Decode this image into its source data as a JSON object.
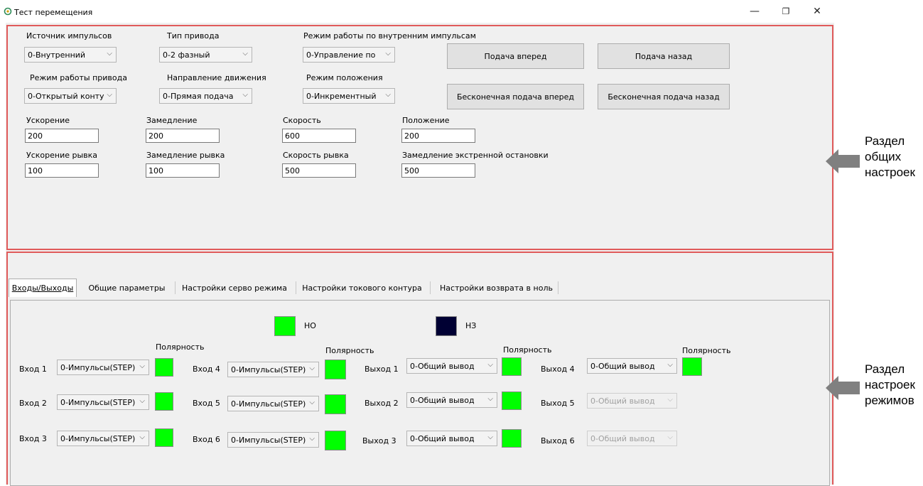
{
  "window": {
    "title": "Тест перемещения",
    "minimize": "—",
    "restore": "❐",
    "close": "✕"
  },
  "general": {
    "labels": {
      "pulse_source": "Источник импульсов",
      "drive_type": "Тип привода",
      "internal_mode": "Режим работы по внутренним импульсам",
      "drive_mode": "Режим работы привода",
      "direction": "Направление движения",
      "position_mode": "Режим положения",
      "acceleration": "Ускорение",
      "deceleration": "Замедление",
      "speed": "Скорость",
      "position": "Положение",
      "jerk_accel": "Ускорение рывка",
      "jerk_decel": "Замедление рывка",
      "jerk_speed": "Скорость рывка",
      "estop_decel": "Замедление экстренной остановки"
    },
    "combos": {
      "pulse_source": "0-Внутренний",
      "drive_type": "0-2 фазный",
      "internal_mode": "0-Управление по",
      "drive_mode": "0-Открытый конту",
      "direction": "0-Прямая подача",
      "position_mode": "0-Инкрементный"
    },
    "values": {
      "acceleration": "200",
      "deceleration": "200",
      "speed": "600",
      "position": "200",
      "jerk_accel": "100",
      "jerk_decel": "100",
      "jerk_speed": "500",
      "estop_decel": "500"
    },
    "buttons": {
      "feed_forward": "Подача вперед",
      "feed_back": "Подача назад",
      "infinite_forward": "Бесконечная подача вперед",
      "infinite_back": "Бесконечная подача назад"
    }
  },
  "tabs": [
    "Входы/Выходы",
    "Общие параметры",
    "Настройки серво режима",
    "Настройки токового контура",
    "Настройки возврата в ноль"
  ],
  "io": {
    "legend_no": "НО",
    "legend_nz": "НЗ",
    "polarity": "Полярность",
    "inputs": [
      {
        "label": "Вход 1",
        "value": "0-Импульсы(STEP)"
      },
      {
        "label": "Вход 2",
        "value": "0-Импульсы(STEP)"
      },
      {
        "label": "Вход 3",
        "value": "0-Импульсы(STEP)"
      },
      {
        "label": "Вход 4",
        "value": "0-Импульсы(STEP)"
      },
      {
        "label": "Вход 5",
        "value": "0-Импульсы(STEP)"
      },
      {
        "label": "Вход 6",
        "value": "0-Импульсы(STEP)"
      }
    ],
    "outputs": [
      {
        "label": "Выход 1",
        "value": "0-Общий вывод"
      },
      {
        "label": "Выход 2",
        "value": "0-Общий вывод"
      },
      {
        "label": "Выход 3",
        "value": "0-Общий вывод"
      },
      {
        "label": "Выход 4",
        "value": "0-Общий вывод"
      },
      {
        "label": "Выход 5",
        "value": "0-Общий вывод"
      },
      {
        "label": "Выход 6",
        "value": "0-Общий вывод"
      }
    ]
  },
  "annotations": {
    "general_line1": "Раздел",
    "general_line2": "общих",
    "general_line3": "настроек",
    "modes_line1": "Раздел",
    "modes_line2": "настроек",
    "modes_line3": "режимов"
  },
  "colors": {
    "highlight": "#e05a5a",
    "no_green": "#00ff00",
    "nz_navy": "#000033",
    "arrow_gray": "#808080"
  }
}
